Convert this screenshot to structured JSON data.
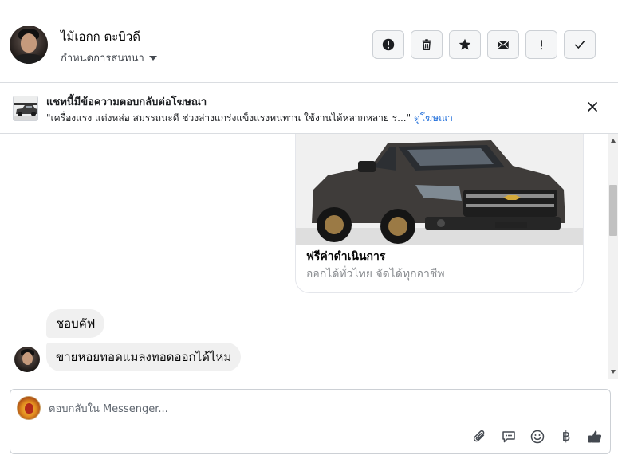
{
  "header": {
    "contact_name": "ไม้เอกก ตะบิวดี",
    "conversation_settings": "กำหนดการสนทนา"
  },
  "ad_banner": {
    "title": "แชทนี้มีข้อความตอบกลับต่อโฆษณา",
    "ad_text": "\"เครื่องแรง แต่งหล่อ สมรรถนะดี ช่วงล่างแกร่งแข็งแรงทนทาน ใช้งานได้หลากหลาย ร...\"",
    "view_ad_link": "ดูโฆษณา"
  },
  "ad_card": {
    "title": "ฟรีค่าดำเนินการ",
    "subtitle": "ออกได้ทั่วไทย จัดได้ทุกอาชีพ"
  },
  "messages": [
    {
      "text": "ชอบคัฟ"
    },
    {
      "text": "ขายหอยทอดแมลงทอดออกได้ไหม"
    }
  ],
  "composer": {
    "placeholder": "ตอบกลับใน Messenger...",
    "currency_symbol": "฿"
  },
  "colors": {
    "link": "#216fdb",
    "bubble_bg": "#f0f0f0",
    "icon": "#444950"
  }
}
